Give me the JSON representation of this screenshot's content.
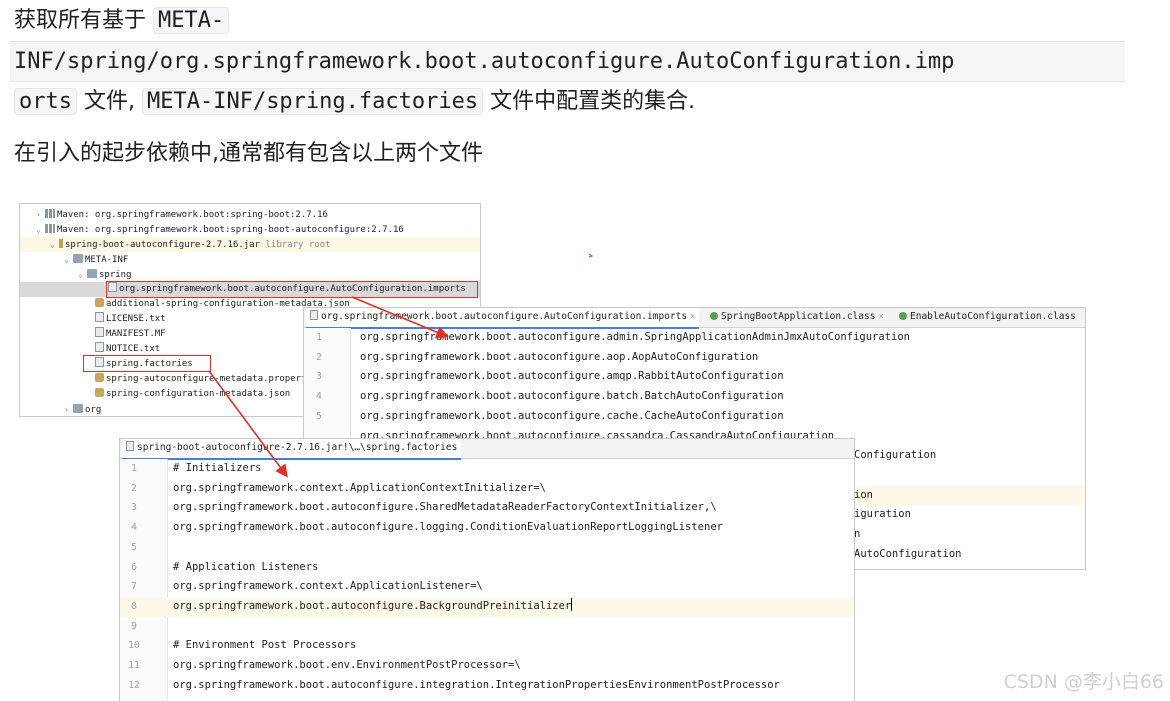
{
  "article": {
    "line1_prefix": "获取所有基于",
    "line1_code": "META-",
    "line2_code": "INF/spring/org.springframework.boot.autoconfigure.AutoConfiguration.imp",
    "line3_code_a": "orts",
    "line3_text_a": "文件,",
    "line3_code_b": "META-INF/spring.factories",
    "line3_text_b": "文件中配置类的集合.",
    "line4": "在引入的起步依赖中,通常都有包含以上两个文件"
  },
  "tree": {
    "rows": [
      {
        "arrow": "›",
        "icon": "lib",
        "label": "Maven: org.springframework.boot:spring-boot:2.7.16",
        "extra": ""
      },
      {
        "arrow": "⌄",
        "icon": "lib",
        "label": "Maven: org.springframework.boot:spring-boot-autoconfigure:2.7.16",
        "extra": ""
      },
      {
        "arrow": "⌄",
        "icon": "jar",
        "label": "spring-boot-autoconfigure-2.7.16.jar",
        "extra": "library root"
      },
      {
        "arrow": "⌄",
        "icon": "folder",
        "label": "META-INF",
        "extra": ""
      },
      {
        "arrow": "⌄",
        "icon": "folder",
        "label": "spring",
        "extra": ""
      },
      {
        "arrow": "",
        "icon": "file",
        "label": "org.springframework.boot.autoconfigure.AutoConfiguration.imports",
        "extra": ""
      },
      {
        "arrow": "",
        "icon": "json",
        "label": "additional-spring-configuration-metadata.json",
        "extra": ""
      },
      {
        "arrow": "",
        "icon": "file",
        "label": "LICENSE.txt",
        "extra": ""
      },
      {
        "arrow": "",
        "icon": "file",
        "label": "MANIFEST.MF",
        "extra": ""
      },
      {
        "arrow": "",
        "icon": "file",
        "label": "NOTICE.txt",
        "extra": ""
      },
      {
        "arrow": "",
        "icon": "file",
        "label": "spring.factories",
        "extra": ""
      },
      {
        "arrow": "",
        "icon": "json",
        "label": "spring-autoconfigure-metadata.properties",
        "extra": ""
      },
      {
        "arrow": "",
        "icon": "json",
        "label": "spring-configuration-metadata.json",
        "extra": ""
      },
      {
        "arrow": "›",
        "icon": "folder",
        "label": "org",
        "extra": ""
      }
    ]
  },
  "imports_editor": {
    "tabs": [
      {
        "label": "org.springframework.boot.autoconfigure.AutoConfiguration.imports",
        "close": "×",
        "icon": "file"
      },
      {
        "label": "SpringBootApplication.class",
        "close": "×",
        "icon": "class"
      },
      {
        "label": "EnableAutoConfiguration.class",
        "close": "",
        "icon": "class"
      }
    ],
    "lines": [
      {
        "num": "1",
        "text": "org.springframework.boot.autoconfigure.admin.SpringApplicationAdminJmxAutoConfiguration"
      },
      {
        "num": "2",
        "text": "org.springframework.boot.autoconfigure.aop.AopAutoConfiguration"
      },
      {
        "num": "3",
        "text": "org.springframework.boot.autoconfigure.amqp.RabbitAutoConfiguration"
      },
      {
        "num": "4",
        "text": "org.springframework.boot.autoconfigure.batch.BatchAutoConfiguration"
      },
      {
        "num": "5",
        "text": "org.springframework.boot.autoconfigure.cache.CacheAutoConfiguration"
      },
      {
        "num": "",
        "text": "org.springframework.boot.autoconfigure.cassandra.CassandraAutoConfiguration"
      },
      {
        "num": "",
        "text": "Configuration"
      },
      {
        "num": "",
        "text": ""
      },
      {
        "num": "",
        "text": "ion"
      },
      {
        "num": "",
        "text": "iguration"
      },
      {
        "num": "",
        "text": "n"
      },
      {
        "num": "",
        "text": "AutoConfiguration"
      }
    ]
  },
  "factories_editor": {
    "tab": "spring-boot-autoconfigure-2.7.16.jar!\\…\\spring.factories",
    "lines": [
      {
        "num": "1",
        "text": "# Initializers"
      },
      {
        "num": "2",
        "text": "org.springframework.context.ApplicationContextInitializer=\\"
      },
      {
        "num": "3",
        "text": "org.springframework.boot.autoconfigure.SharedMetadataReaderFactoryContextInitializer,\\"
      },
      {
        "num": "4",
        "text": "org.springframework.boot.autoconfigure.logging.ConditionEvaluationReportLoggingListener"
      },
      {
        "num": "5",
        "text": ""
      },
      {
        "num": "6",
        "text": "# Application Listeners"
      },
      {
        "num": "7",
        "text": "org.springframework.context.ApplicationListener=\\"
      },
      {
        "num": "8",
        "text": "org.springframework.boot.autoconfigure.BackgroundPreinitializer"
      },
      {
        "num": "9",
        "text": ""
      },
      {
        "num": "10",
        "text": "# Environment Post Processors"
      },
      {
        "num": "11",
        "text": "org.springframework.boot.env.EnvironmentPostProcessor=\\"
      },
      {
        "num": "12",
        "text": "org.springframework.boot.autoconfigure.integration.IntegrationPropertiesEnvironmentPostProcessor"
      }
    ]
  },
  "watermark": "CSDN @李小白66",
  "colors": {
    "annotation_red": "#e0302a",
    "tab_underline": "#4a7dd6",
    "class_icon": "#5a9e55"
  }
}
